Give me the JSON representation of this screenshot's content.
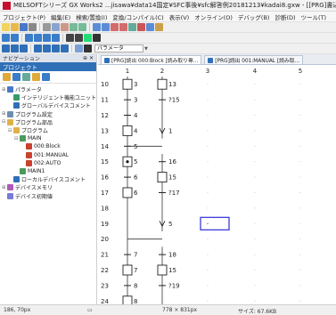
{
  "window": {
    "title": "MELSOFTシリーズ GX Works2 ...jisawa¥data14国定¥SFC事後¥sfc解答例20181213¥kadai8.gxw - [[PRG]書込 002:AUTO 30"
  },
  "menu": [
    "プロジェクト(P)",
    "編集(E)",
    "検索/置換(I)",
    "変換/コンパイル(C)",
    "表示(V)",
    "オンライン(O)",
    "デバッグ(B)",
    "診断(D)",
    "ツール(T)"
  ],
  "toolbar3": {
    "combo_value": "パラメータ"
  },
  "navigation": {
    "header": "ナビゲーション",
    "pin": "⊕ ✕",
    "project_title": "プロジェクト"
  },
  "tree": [
    {
      "label": "パラメータ",
      "icon": "param-icon",
      "indent": 0,
      "exp": "⊞"
    },
    {
      "label": "インテリジェント機能ユニット",
      "icon": "module-icon",
      "indent": 1,
      "exp": ""
    },
    {
      "label": "グローバルデバイスコメント",
      "icon": "comment-icon",
      "indent": 1,
      "exp": ""
    },
    {
      "label": "プログラム設定",
      "icon": "settings-icon",
      "indent": 0,
      "exp": "⊞"
    },
    {
      "label": "プログラム部品",
      "icon": "folder-icon",
      "indent": 0,
      "exp": "⊟"
    },
    {
      "label": "プログラム",
      "icon": "folder-icon",
      "indent": 1,
      "exp": "⊟"
    },
    {
      "label": "MAIN",
      "icon": "program-icon",
      "indent": 2,
      "exp": "⊟"
    },
    {
      "label": "000:Block",
      "icon": "block-icon",
      "indent": 3,
      "exp": ""
    },
    {
      "label": "001:MANUAL",
      "icon": "block-icon",
      "indent": 3,
      "exp": ""
    },
    {
      "label": "002:AUTO",
      "icon": "block-icon",
      "indent": 3,
      "exp": ""
    },
    {
      "label": "MAIN1",
      "icon": "program-icon",
      "indent": 2,
      "exp": ""
    },
    {
      "label": "ローカルデバイスコメント",
      "icon": "comment-icon",
      "indent": 1,
      "exp": ""
    },
    {
      "label": "デバイスメモリ",
      "icon": "memory-icon",
      "indent": 0,
      "exp": "⊞"
    },
    {
      "label": "デバイス初期値",
      "icon": "init-icon",
      "indent": 0,
      "exp": ""
    }
  ],
  "tabs": [
    {
      "label": "[PRG]読出 000:Block [読み取り専..."
    },
    {
      "label": "[PRG]読出 001:MANUAL [読み取..."
    }
  ],
  "sfc": {
    "columns": [
      "1",
      "2",
      "3",
      "4",
      "5"
    ],
    "rows": [
      "10",
      "11",
      "12",
      "13",
      "14",
      "15",
      "16",
      "17",
      "18",
      "19",
      "20",
      "21",
      "22",
      "23",
      "24"
    ],
    "col1": [
      {
        "row": 0,
        "kind": "step",
        "label": "3"
      },
      {
        "row": 1,
        "kind": "trans",
        "label": "3"
      },
      {
        "row": 2,
        "kind": "trans",
        "label": "4"
      },
      {
        "row": 3,
        "kind": "step",
        "label": "4"
      },
      {
        "row": 4,
        "kind": "trans",
        "label": "5"
      },
      {
        "row": 5,
        "kind": "active",
        "label": "5"
      },
      {
        "row": 6,
        "kind": "trans",
        "label": "6"
      },
      {
        "row": 7,
        "kind": "step",
        "label": "6"
      },
      {
        "row": 8,
        "kind": "none",
        "label": ""
      },
      {
        "row": 9,
        "kind": "none",
        "label": ""
      },
      {
        "row": 10,
        "kind": "none",
        "label": ""
      },
      {
        "row": 11,
        "kind": "trans",
        "label": "7"
      },
      {
        "row": 12,
        "kind": "step",
        "label": "7"
      },
      {
        "row": 13,
        "kind": "trans",
        "label": "8"
      },
      {
        "row": 14,
        "kind": "step",
        "label": "8"
      }
    ],
    "col2": [
      {
        "row": 0,
        "kind": "step",
        "label": "13"
      },
      {
        "row": 1,
        "kind": "trans",
        "label": "?15"
      },
      {
        "row": 3,
        "kind": "jump",
        "label": "1"
      },
      {
        "row": 5,
        "kind": "trans",
        "label": "16"
      },
      {
        "row": 6,
        "kind": "step",
        "label": "15"
      },
      {
        "row": 7,
        "kind": "trans",
        "label": "?17"
      },
      {
        "row": 9,
        "kind": "jump",
        "label": "5"
      },
      {
        "row": 11,
        "kind": "trans",
        "label": "18"
      },
      {
        "row": 12,
        "kind": "step",
        "label": "15"
      },
      {
        "row": 13,
        "kind": "trans",
        "label": "?19"
      }
    ],
    "cursor": {
      "row": 9,
      "col": 3
    }
  },
  "status": {
    "coords": "186, 70px",
    "size": "778 × 831px",
    "file": "サイズ: 67.6KB"
  }
}
